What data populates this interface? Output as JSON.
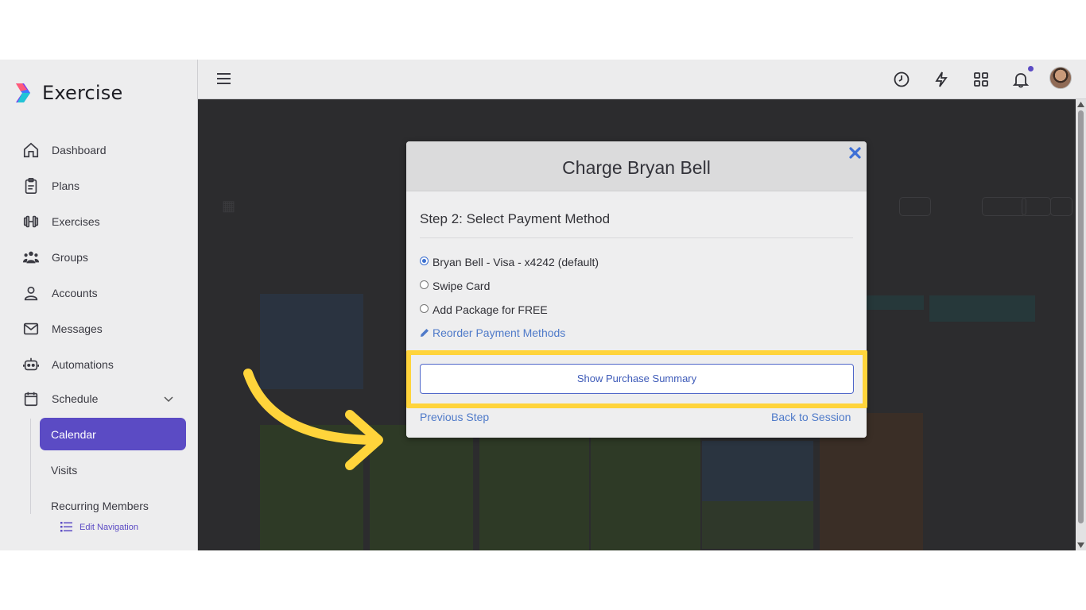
{
  "app": {
    "name": "Exercise"
  },
  "sidebar": {
    "items": [
      {
        "label": "Dashboard",
        "icon": "home-icon"
      },
      {
        "label": "Plans",
        "icon": "clipboard-icon"
      },
      {
        "label": "Exercises",
        "icon": "dumbbell-icon"
      },
      {
        "label": "Groups",
        "icon": "users-icon"
      },
      {
        "label": "Accounts",
        "icon": "user-icon"
      },
      {
        "label": "Messages",
        "icon": "mail-icon"
      },
      {
        "label": "Automations",
        "icon": "robot-icon"
      },
      {
        "label": "Schedule",
        "icon": "calendar-icon"
      }
    ],
    "schedule_sub": [
      {
        "label": "Calendar",
        "active": true
      },
      {
        "label": "Visits"
      },
      {
        "label": "Recurring Members"
      }
    ],
    "edit_navigation": "Edit Navigation",
    "accent": "#5b4bc4"
  },
  "topbar": {
    "icons": [
      "menu-icon",
      "clock-icon",
      "lightning-icon",
      "apps-grid-icon",
      "bell-icon",
      "avatar"
    ]
  },
  "modal": {
    "title": "Charge Bryan Bell",
    "step_title": "Step 2: Select Payment Method",
    "options": [
      {
        "label": "Bryan Bell - Visa - x4242 (default)",
        "selected": true
      },
      {
        "label": "Swipe Card",
        "selected": false
      },
      {
        "label": "Add Package for FREE",
        "selected": false
      }
    ],
    "reorder_link": "Reorder Payment Methods",
    "primary_button": "Show Purchase Summary",
    "previous_step": "Previous Step",
    "back_to_session": "Back to Session"
  },
  "highlight_color": "#ffd43b"
}
